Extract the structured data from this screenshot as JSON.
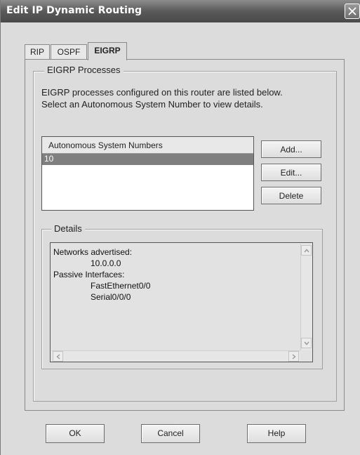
{
  "window": {
    "title": "Edit IP Dynamic Routing"
  },
  "tabs": [
    {
      "label": "RIP",
      "selected": false
    },
    {
      "label": "OSPF",
      "selected": false
    },
    {
      "label": "EIGRP",
      "selected": true
    }
  ],
  "eigrp_processes": {
    "legend": "EIGRP Processes",
    "description_line1": "EIGRP processes configured on this router are listed below.",
    "description_line2": "Select an Autonomous System Number to view details.",
    "list": {
      "header": "Autonomous System Numbers",
      "items": [
        "10"
      ],
      "selected_index": 0
    },
    "buttons": {
      "add": "Add...",
      "edit": "Edit...",
      "delete": "Delete"
    }
  },
  "details": {
    "legend": "Details",
    "networks_label": "Networks advertised:",
    "networks": [
      "10.0.0.0"
    ],
    "passive_label": "Passive Interfaces:",
    "passive_interfaces": [
      "FastEthernet0/0",
      "Serial0/0/0"
    ]
  },
  "footer": {
    "ok": "OK",
    "cancel": "Cancel",
    "help": "Help"
  },
  "colors": {
    "title_bar": "#5a5a5a",
    "dialog_bg": "#dcdcdc",
    "selection": "#7f7f7f"
  }
}
